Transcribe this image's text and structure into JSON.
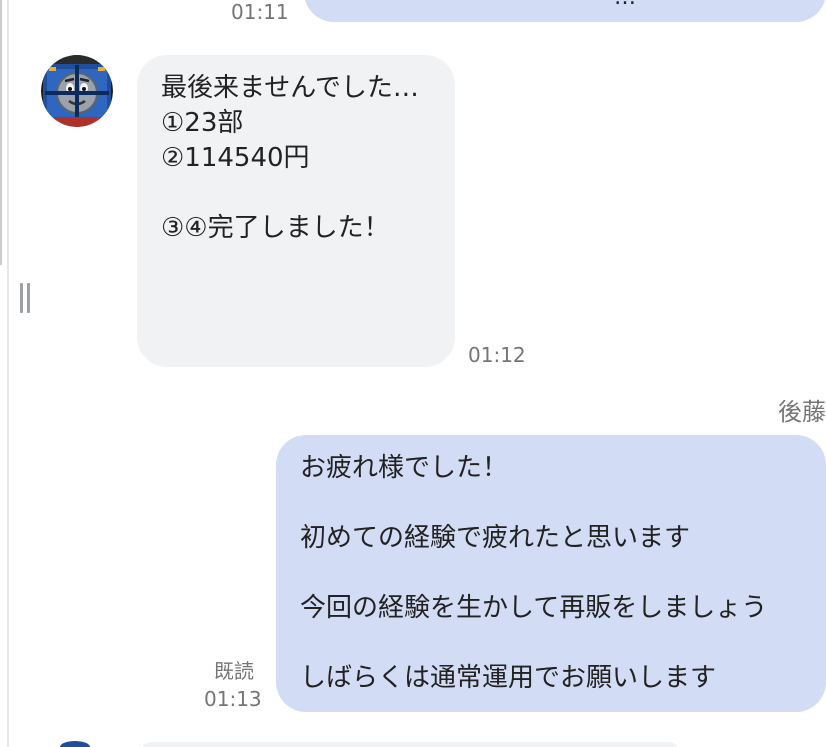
{
  "messages": [
    {
      "direction": "outgoing",
      "time": "01:11",
      "partial_text": "…"
    },
    {
      "direction": "incoming",
      "lines": [
        "最後来ませんでした…",
        "①23部",
        "②114540円",
        "",
        "③④完了しました！"
      ],
      "time": "01:12"
    },
    {
      "direction": "outgoing",
      "sender": "後藤",
      "lines": [
        "お疲れ様でした！",
        "",
        "初めての経験で疲れたと思います",
        "",
        "今回の経験を生かして再販をしましょう",
        "",
        "しばらくは通常運用でお願いします"
      ],
      "read_status": "既読",
      "time": "01:13"
    }
  ],
  "colors": {
    "outgoing_bubble": "#d2dcf4",
    "incoming_bubble": "#f1f2f4",
    "meta_text": "#757575",
    "message_text": "#222222"
  },
  "icons": {
    "avatar": "train-face-avatar",
    "resize_handle": "double-bar-resize-handle"
  }
}
